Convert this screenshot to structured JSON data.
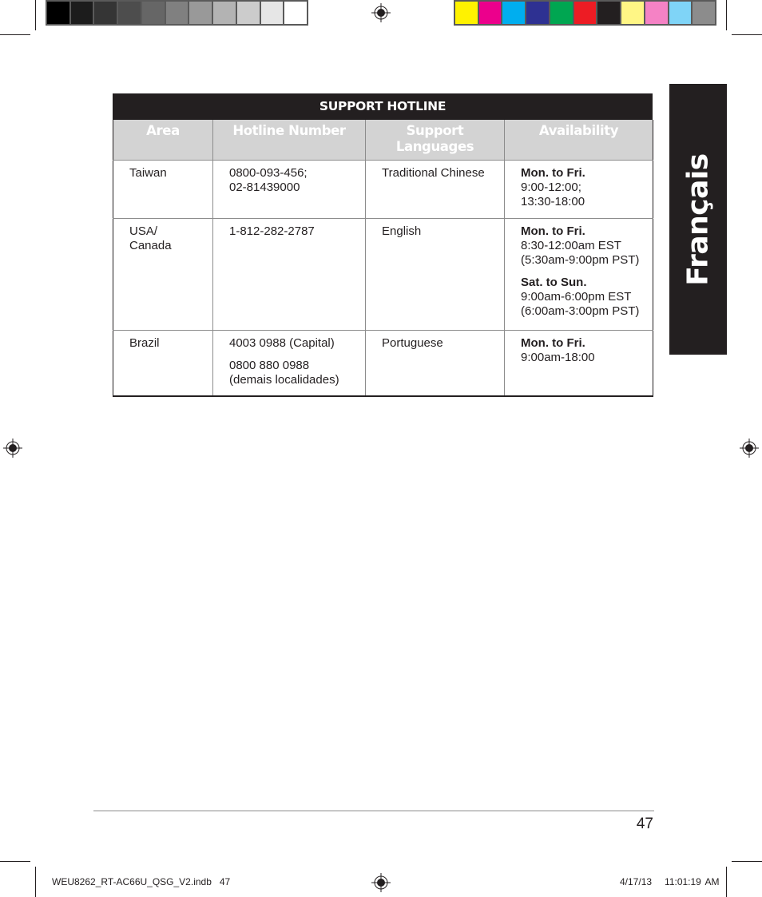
{
  "colorbars": {
    "gray": [
      "#000000",
      "#1c1c1c",
      "#353535",
      "#4d4d4d",
      "#666666",
      "#808080",
      "#999999",
      "#b3b3b3",
      "#cccccc",
      "#e6e6e6",
      "#ffffff"
    ],
    "cmyk": [
      "#fff200",
      "#ec008c",
      "#00aeef",
      "#2e3192",
      "#00a651",
      "#ed1c24",
      "#231f20",
      "#fff685",
      "#f582c5",
      "#7fd4f7",
      "#8c8c8c"
    ]
  },
  "table": {
    "title": "SUPPORT HOTLINE",
    "headers": {
      "area": "Area",
      "hotline": "Hotline Number",
      "languages_1": "Support",
      "languages_2": "Languages",
      "availability": "Availability"
    },
    "rows": [
      {
        "area_1": "Taiwan",
        "hotline_1": "0800-093-456;",
        "hotline_2": "02-81439000",
        "language": "Traditional Chinese",
        "avail_heading_1": "Mon. to Fri.",
        "avail_line_1": "9:00-12:00;",
        "avail_line_2": "13:30-18:00"
      },
      {
        "area_1": "USA/",
        "area_2": "Canada",
        "hotline_1": "1-812-282-2787",
        "language": "English",
        "avail_heading_1": "Mon. to Fri.",
        "avail_line_1": "8:30-12:00am EST",
        "avail_line_2": "(5:30am-9:00pm PST)",
        "avail_heading_2": "Sat. to Sun.",
        "avail_line_3": "9:00am-6:00pm EST",
        "avail_line_4": "(6:00am-3:00pm PST)"
      },
      {
        "area_1": "Brazil",
        "hotline_1": "4003 0988 (Capital)",
        "hotline_2": "0800 880 0988",
        "hotline_3": "(demais localidades)",
        "language": "Portuguese",
        "avail_heading_1": "Mon. to Fri.",
        "avail_line_1": "9:00am-18:00"
      }
    ]
  },
  "side_tab": {
    "label": "Français"
  },
  "footer": {
    "page_number": "47",
    "slug_file": "WEU8262_RT-AC66U_QSG_V2.indb   47",
    "slug_datetime": "4/17/13   11:01:19 AM"
  }
}
